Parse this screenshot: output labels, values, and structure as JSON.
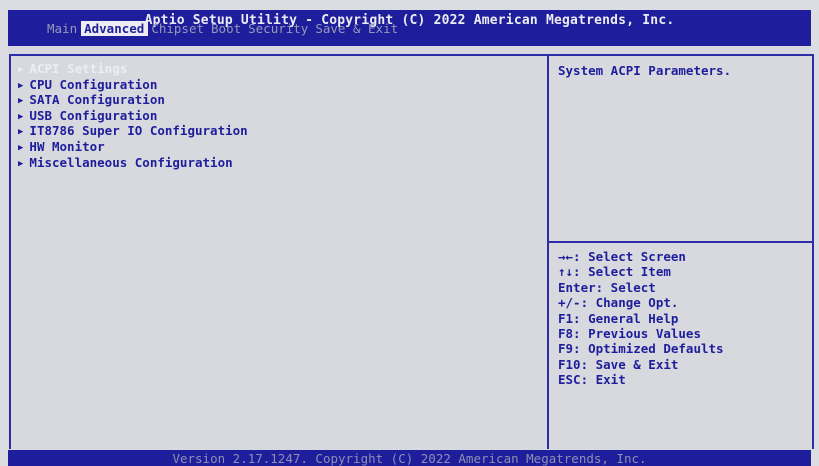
{
  "header": {
    "title": "Aptio Setup Utility - Copyright (C) 2022 American Megatrends, Inc."
  },
  "tabs": [
    {
      "label": "Main"
    },
    {
      "label": "Advanced"
    },
    {
      "label": "Chipset"
    },
    {
      "label": "Boot"
    },
    {
      "label": "Security"
    },
    {
      "label": "Save & Exit"
    }
  ],
  "menu": {
    "arrow_icon": "triangle-right-icon",
    "items": [
      {
        "label": "ACPI Settings"
      },
      {
        "label": "CPU Configuration"
      },
      {
        "label": "SATA Configuration"
      },
      {
        "label": "USB Configuration"
      },
      {
        "label": "IT8786 Super IO Configuration"
      },
      {
        "label": "HW Monitor"
      },
      {
        "label": "Miscellaneous Configuration"
      }
    ]
  },
  "help": {
    "description": "System ACPI Parameters.",
    "keys": [
      {
        "text": "→←: Select Screen"
      },
      {
        "text": "↑↓: Select Item"
      },
      {
        "text": "Enter: Select"
      },
      {
        "text": "+/-: Change Opt."
      },
      {
        "text": "F1: General Help"
      },
      {
        "text": "F8: Previous Values"
      },
      {
        "text": "F9: Optimized Defaults"
      },
      {
        "text": "F10: Save & Exit"
      },
      {
        "text": "ESC: Exit"
      }
    ]
  },
  "footer": {
    "text": "Version 2.17.1247. Copyright (C) 2022 American Megatrends, Inc."
  },
  "colors": {
    "bios_blue": "#1e1e9c",
    "panel_bg": "#d8d9de",
    "highlight_text": "#ededf5",
    "dim_text": "#9898b8"
  }
}
